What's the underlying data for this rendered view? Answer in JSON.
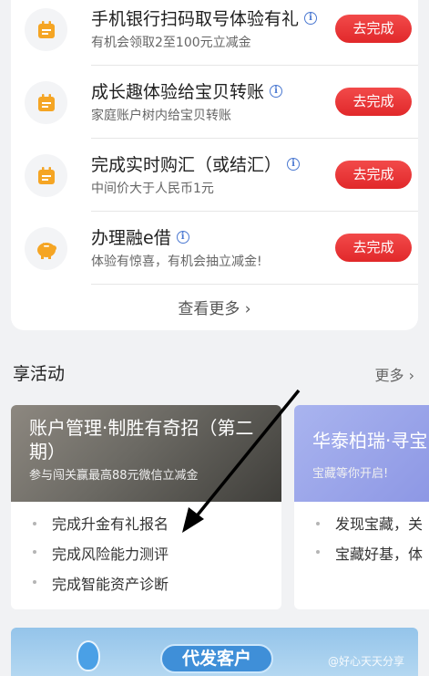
{
  "tasks": [
    {
      "title": "手机银行扫码取号体验有礼",
      "subtitle": "有机会领取2至100元立减金",
      "button": "去完成",
      "icon": "calendar-icon"
    },
    {
      "title": "成长趣体验给宝贝转账",
      "subtitle": "家庭账户树内给宝贝转账",
      "button": "去完成",
      "icon": "calendar-icon"
    },
    {
      "title": "完成实时购汇（或结汇）",
      "subtitle": "中间价大于人民币1元",
      "button": "去完成",
      "icon": "calendar-icon"
    },
    {
      "title": "办理融e借",
      "subtitle": "体验有惊喜，有机会抽立减金!",
      "button": "去完成",
      "icon": "piggy-bank-icon"
    }
  ],
  "view_more": "查看更多",
  "activities": {
    "heading": "享活动",
    "more": "更多",
    "cards": [
      {
        "title": "账户管理·制胜有奇招（第二期）",
        "subtitle": "参与闯关赢最高88元微信立减金",
        "items": [
          "完成升金有礼报名",
          "完成风险能力测评",
          "完成智能资产诊断"
        ]
      },
      {
        "title": "华泰柏瑞·寻宝",
        "subtitle": "宝藏等你开启!",
        "items": [
          "发现宝藏，关",
          "宝藏好基，体"
        ]
      }
    ]
  },
  "promo": {
    "label": "代发客户"
  },
  "watermark": "@好心天天分享",
  "colors": {
    "button_red": "#e1282a",
    "icon_orange": "#f5a524",
    "link_blue": "#4a78d1"
  }
}
